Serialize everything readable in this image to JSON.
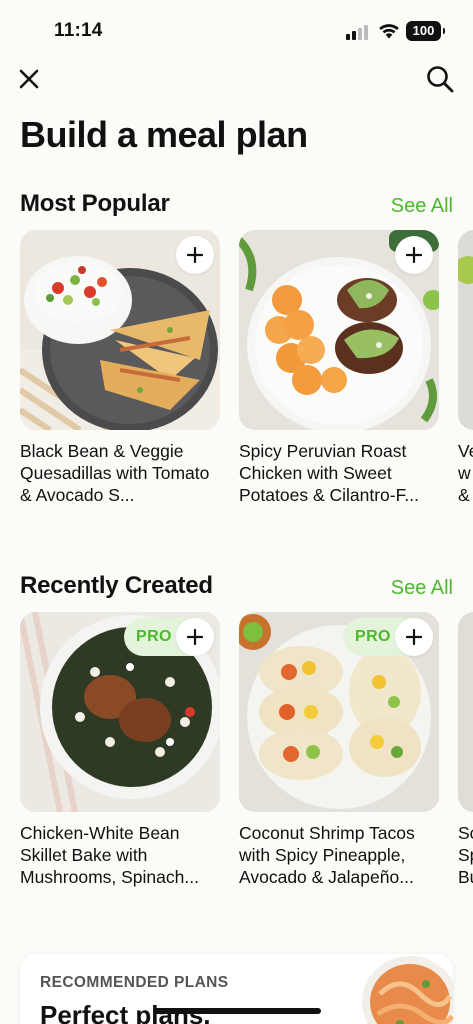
{
  "status_bar": {
    "time": "11:14",
    "battery": "100"
  },
  "header": {
    "title": "Build a meal plan"
  },
  "sections": {
    "popular": {
      "title": "Most Popular",
      "see_all": "See All",
      "items": [
        {
          "name": "Black Bean & Veggie Quesadillas with Tomato & Avocado S..."
        },
        {
          "name": "Spicy Peruvian Roast Chicken with Sweet Potatoes & Cilantro-F..."
        },
        {
          "name": "Ve\nw\n&"
        }
      ]
    },
    "recent": {
      "title": "Recently Created",
      "see_all": "See All",
      "badge": "PRO",
      "items": [
        {
          "name": "Chicken-White Bean Skillet Bake with Mushrooms, Spinach..."
        },
        {
          "name": "Coconut Shrimp Tacos with Spicy Pineapple, Avocado & Jalapeño..."
        },
        {
          "name": "Sc\nSp\nBu"
        }
      ]
    }
  },
  "recommended": {
    "label": "RECOMMENDED PLANS",
    "title": "Perfect plans,"
  },
  "colors": {
    "accent": "#4cb82d",
    "background": "#fbfbf8",
    "pro_bg": "#e3f4db"
  },
  "icons": {
    "close": "close-icon",
    "search": "search-icon",
    "add": "plus-icon"
  }
}
